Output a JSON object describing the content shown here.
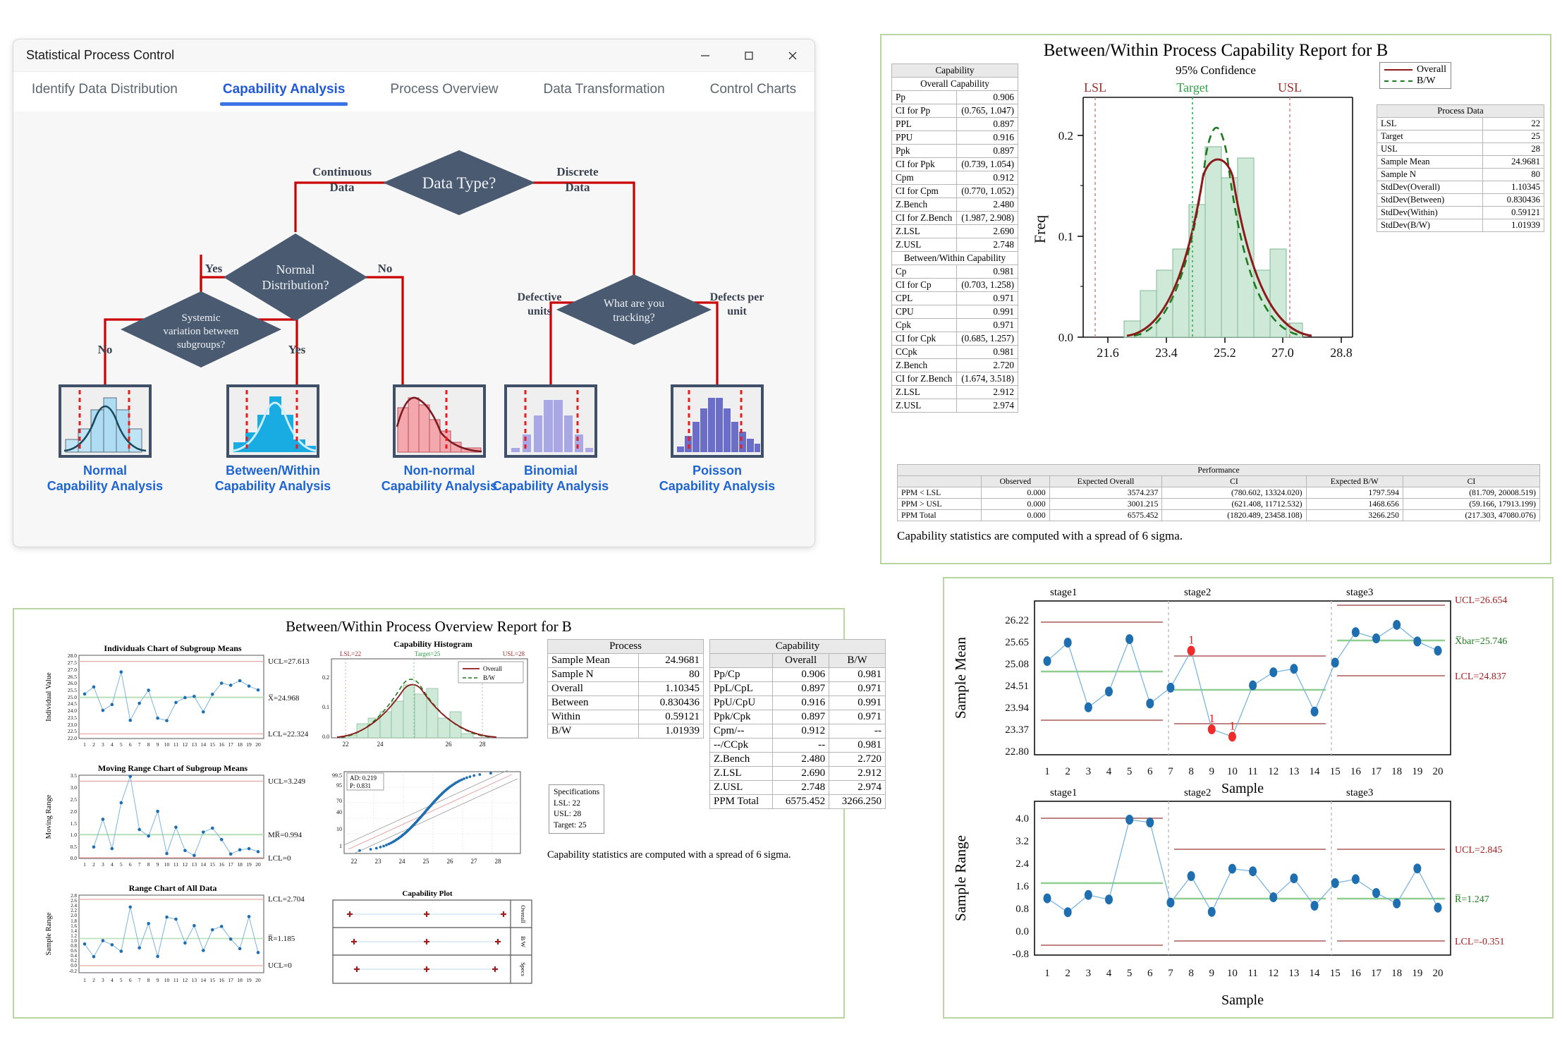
{
  "window": {
    "title": "Statistical Process Control",
    "controls": {
      "minimize": "—",
      "maximize": "☐",
      "close": "✕"
    },
    "tabs": [
      {
        "label": "Identify Data Distribution",
        "active": false
      },
      {
        "label": "Capability Analysis",
        "active": true
      },
      {
        "label": "Process Overview",
        "active": false
      },
      {
        "label": "Data Transformation",
        "active": false
      },
      {
        "label": "Control Charts",
        "active": false
      }
    ]
  },
  "flowchart": {
    "nodes": {
      "data_type": "Data Type?",
      "normal_dist": "Normal\nDistribution?",
      "systemic": "Systemic\nvariation between\nsubgroups?",
      "tracking": "What are you\ntracking?"
    },
    "edge_labels": {
      "continuous": "Continuous\nData",
      "discrete": "Discrete\nData",
      "norm_yes": "Yes",
      "norm_no": "No",
      "sys_no": "No",
      "sys_yes": "Yes",
      "defective": "Defective\nunits",
      "defects": "Defects per\nunit"
    },
    "outcomes": [
      {
        "name": "Normal",
        "sub": "Capability Analysis",
        "thumb": "normal-histogram"
      },
      {
        "name": "Between/Within",
        "sub": "Capability Analysis",
        "thumb": "between-within-histogram"
      },
      {
        "name": "Non-normal",
        "sub": "Capability Analysis",
        "thumb": "nonnormal-histogram"
      },
      {
        "name": "Binomial",
        "sub": "Capability Analysis",
        "thumb": "binomial-histogram"
      },
      {
        "name": "Poisson",
        "sub": "Capability Analysis",
        "thumb": "poisson-histogram"
      }
    ],
    "colors": {
      "node": "#4a5a70",
      "edge": "#cc0000",
      "label": "#1e64d2"
    }
  },
  "capability_report": {
    "title": "Between/Within Process Capability Report for B",
    "subtitle": "95% Confidence",
    "footnote": "Capability statistics are computed with a spread of 6 sigma.",
    "capability_table": {
      "header": "Capability",
      "section1": "Overall Capability",
      "rows1": [
        [
          "Pp",
          "0.906"
        ],
        [
          "CI for Pp",
          "(0.765, 1.047)"
        ],
        [
          "PPL",
          "0.897"
        ],
        [
          "PPU",
          "0.916"
        ],
        [
          "Ppk",
          "0.897"
        ],
        [
          "CI for Ppk",
          "(0.739, 1.054)"
        ],
        [
          "Cpm",
          "0.912"
        ],
        [
          "CI for Cpm",
          "(0.770, 1.052)"
        ],
        [
          "Z.Bench",
          "2.480"
        ],
        [
          "CI for Z.Bench",
          "(1.987, 2.908)"
        ],
        [
          "Z.LSL",
          "2.690"
        ],
        [
          "Z.USL",
          "2.748"
        ]
      ],
      "section2": "Between/Within Capability",
      "rows2": [
        [
          "Cp",
          "0.981"
        ],
        [
          "CI for Cp",
          "(0.703, 1.258)"
        ],
        [
          "CPL",
          "0.971"
        ],
        [
          "CPU",
          "0.991"
        ],
        [
          "Cpk",
          "0.971"
        ],
        [
          "CI for Cpk",
          "(0.685, 1.257)"
        ],
        [
          "CCpk",
          "0.981"
        ],
        [
          "Z.Bench",
          "2.720"
        ],
        [
          "CI for Z.Bench",
          "(1.674, 3.518)"
        ],
        [
          "Z.LSL",
          "2.912"
        ],
        [
          "Z.USL",
          "2.974"
        ]
      ]
    },
    "legend": {
      "overall": "Overall",
      "bw": "B/W"
    },
    "process_data": {
      "header": "Process Data",
      "rows": [
        [
          "LSL",
          "22"
        ],
        [
          "Target",
          "25"
        ],
        [
          "USL",
          "28"
        ],
        [
          "Sample Mean",
          "24.9681"
        ],
        [
          "Sample N",
          "80"
        ],
        [
          "StdDev(Overall)",
          "1.10345"
        ],
        [
          "StdDev(Between)",
          "0.830436"
        ],
        [
          "StdDev(Within)",
          "0.59121"
        ],
        [
          "StdDev(B/W)",
          "1.01939"
        ]
      ]
    },
    "performance": {
      "header": "Performance",
      "columns": [
        "",
        "Observed",
        "Expected Overall",
        "CI",
        "Expected B/W",
        "CI"
      ],
      "rows": [
        [
          "PPM < LSL",
          "0.000",
          "3574.237",
          "(780.602, 13324.020)",
          "1797.594",
          "(81.709, 20008.519)"
        ],
        [
          "PPM > USL",
          "0.000",
          "3001.215",
          "(621.408, 11712.532)",
          "1468.656",
          "(59.166, 17913.199)"
        ],
        [
          "PPM Total",
          "0.000",
          "6575.452",
          "(1820.489, 23458.108)",
          "3266.250",
          "(217.303, 47080.076)"
        ]
      ]
    },
    "markers": {
      "lsl": "LSL",
      "target": "Target",
      "usl": "USL"
    }
  },
  "overview_report": {
    "title": "Between/Within Process Overview Report for B",
    "footnote": "Capability statistics are computed with a spread of 6 sigma.",
    "specifications": {
      "header": "Specifications",
      "lines": [
        "LSL: 22",
        "USL: 28",
        "Target: 25"
      ]
    },
    "process_table": {
      "header": "Process",
      "rows": [
        [
          "Sample Mean",
          "24.9681"
        ],
        [
          "Sample N",
          "80"
        ],
        [
          "Overall",
          "1.10345"
        ],
        [
          "Between",
          "0.830436"
        ],
        [
          "Within",
          "0.59121"
        ],
        [
          "B/W",
          "1.01939"
        ]
      ]
    },
    "capability_table": {
      "header": "Capability",
      "columns": [
        "",
        "Overall",
        "B/W"
      ],
      "rows": [
        [
          "Pp/Cp",
          "0.906",
          "0.981"
        ],
        [
          "PpL/CpL",
          "0.897",
          "0.971"
        ],
        [
          "PpU/CpU",
          "0.916",
          "0.991"
        ],
        [
          "Ppk/Cpk",
          "0.897",
          "0.971"
        ],
        [
          "Cpm/--",
          "0.912",
          "--"
        ],
        [
          "--/CCpk",
          "--",
          "0.981"
        ],
        [
          "Z.Bench",
          "2.480",
          "2.720"
        ],
        [
          "Z.LSL",
          "2.690",
          "2.912"
        ],
        [
          "Z.USL",
          "2.748",
          "2.974"
        ],
        [
          "PPM Total",
          "6575.452",
          "3266.250"
        ]
      ]
    },
    "capability_plot": {
      "title": "Capability Plot",
      "rows": [
        "Overall",
        "B/W",
        "Specs"
      ]
    },
    "anderson_darling": {
      "ad": "AD: 0.219",
      "p": "P: 0.831"
    },
    "legend": {
      "overall": "Overall",
      "bw": "B/W"
    }
  },
  "chart_data": [
    {
      "type": "bar",
      "id": "capability-histogram-main",
      "title": "Between/Within Process Capability Report for B",
      "xlabel": "",
      "ylabel": "Freq",
      "xticks": [
        "21.6",
        "23.4",
        "25.2",
        "27.0",
        "28.8"
      ],
      "yticks": [
        "0.0",
        "0.1",
        "0.2"
      ],
      "xlim": [
        21.0,
        29.4
      ],
      "ylim": [
        0.0,
        0.235
      ],
      "bin_edges": [
        22.1,
        22.6,
        23.1,
        23.6,
        24.1,
        24.6,
        25.1,
        25.6,
        26.1,
        26.6,
        27.1,
        27.6
      ],
      "values": [
        0.015,
        0.043,
        0.062,
        0.082,
        0.124,
        0.178,
        0.149,
        0.167,
        0.062,
        0.082,
        0.013
      ],
      "curves": [
        {
          "name": "Overall",
          "color": "#8b1a1a",
          "style": "solid",
          "mean": 24.9681,
          "sd": 1.10345,
          "peak": 0.172
        },
        {
          "name": "B/W",
          "color": "#1e7a1e",
          "style": "dashed",
          "mean": 25.05,
          "sd": 1.01939,
          "peak": 0.192
        }
      ],
      "reference_lines": [
        {
          "label": "LSL",
          "value": 22,
          "color": "#b03030"
        },
        {
          "label": "Target",
          "value": 25,
          "color": "#2f9e44"
        },
        {
          "label": "USL",
          "value": 28,
          "color": "#b03030"
        }
      ]
    },
    {
      "type": "line",
      "id": "individuals-chart",
      "title": "Individuals Chart of Subgroup Means",
      "xlabel": "",
      "ylabel": "Individual Value",
      "categories": [
        1,
        2,
        3,
        4,
        5,
        6,
        7,
        8,
        9,
        10,
        11,
        12,
        13,
        14,
        15,
        16,
        17,
        18,
        19,
        20
      ],
      "values": [
        25.21,
        25.72,
        24.03,
        24.45,
        26.8,
        23.31,
        24.54,
        25.48,
        23.47,
        23.29,
        24.6,
        24.95,
        25.04,
        23.92,
        25.19,
        25.99,
        25.84,
        26.17,
        25.78,
        25.5
      ],
      "yticks": [
        "22.0",
        "22.5",
        "23.0",
        "23.5",
        "24.0",
        "24.5",
        "25.0",
        "25.5",
        "26.0",
        "26.5",
        "27.0",
        "27.5",
        "28.0"
      ],
      "ylim": [
        22.0,
        28.0
      ],
      "limits": {
        "ucl_label": "UCL=27.613",
        "ucl": 27.613,
        "center_label": "X̅=24.968",
        "center": 24.968,
        "lcl_label": "LCL=22.324",
        "lcl": 22.324
      }
    },
    {
      "type": "line",
      "id": "moving-range-chart",
      "title": "Moving Range Chart of Subgroup Means",
      "xlabel": "",
      "ylabel": "Moving Range",
      "categories": [
        1,
        2,
        3,
        4,
        5,
        6,
        7,
        8,
        9,
        10,
        11,
        12,
        13,
        14,
        15,
        16,
        17,
        18,
        19,
        20
      ],
      "values": [
        null,
        0.47,
        1.66,
        0.4,
        2.37,
        3.5,
        1.22,
        0.94,
        2.0,
        0.19,
        1.32,
        0.32,
        0.11,
        1.11,
        1.28,
        0.79,
        0.17,
        0.35,
        0.4,
        0.27
      ],
      "yticks": [
        "0.0",
        "0.5",
        "1.0",
        "1.5",
        "2.0",
        "2.5",
        "3.0",
        "3.5"
      ],
      "ylim": [
        0.0,
        3.5
      ],
      "limits": {
        "ucl_label": "UCL=3.249",
        "ucl": 3.249,
        "center_label": "MR̅=0.994",
        "center": 0.994,
        "lcl_label": "LCL=0",
        "lcl": 0
      }
    },
    {
      "type": "line",
      "id": "range-chart-all-data",
      "title": "Range Chart of All Data",
      "xlabel": "",
      "ylabel": "Sample Range",
      "categories": [
        1,
        2,
        3,
        4,
        5,
        6,
        7,
        8,
        9,
        10,
        11,
        12,
        13,
        14,
        15,
        16,
        17,
        18,
        19,
        20
      ],
      "values": [
        0.91,
        0.42,
        1.04,
        0.88,
        0.63,
        2.34,
        0.76,
        1.7,
        0.43,
        1.95,
        1.87,
        0.95,
        1.62,
        0.66,
        1.46,
        1.59,
        1.1,
        0.73,
        1.97,
        0.58
      ],
      "yticks": [
        "-0.2",
        "0.0",
        "0.2",
        "0.4",
        "0.6",
        "0.8",
        "1.0",
        "1.2",
        "1.4",
        "1.6",
        "1.8",
        "2.0",
        "2.2",
        "2.4",
        "2.6",
        "2.8"
      ],
      "ylim": [
        -0.2,
        2.8
      ],
      "limits": {
        "ucl_label": "LCL=2.704",
        "ucl": 2.704,
        "center_label": "R̅=1.185",
        "center": 1.185,
        "lcl_label": "UCL=0",
        "lcl": 0
      }
    },
    {
      "type": "bar",
      "id": "capability-histogram-small",
      "title": "Capability Histogram",
      "xticks": [
        "22",
        "24",
        "26",
        "28"
      ],
      "xlim": [
        21.6,
        28.6
      ],
      "bin_edges": [
        22.1,
        22.6,
        23.1,
        23.6,
        24.1,
        24.6,
        25.1,
        25.6,
        26.1,
        26.6,
        27.1,
        27.6
      ],
      "values": [
        0.015,
        0.043,
        0.062,
        0.082,
        0.124,
        0.178,
        0.149,
        0.167,
        0.062,
        0.082,
        0.013
      ],
      "reference_lines": [
        {
          "label": "LSL=22",
          "value": 22,
          "color": "#b03030"
        },
        {
          "label": "Target=25",
          "value": 25,
          "color": "#2f9e44"
        },
        {
          "label": "USL=28",
          "value": 28,
          "color": "#b03030"
        }
      ]
    },
    {
      "type": "scatter",
      "id": "normal-probability-plot",
      "title": "",
      "yticks": [
        "1",
        "10",
        "40",
        "70",
        "95",
        "99.5"
      ],
      "xticks": [
        "22",
        "23",
        "24",
        "25",
        "26",
        "27",
        "28"
      ],
      "annotation": [
        "AD: 0.219",
        "P: 0.831"
      ]
    },
    {
      "type": "line",
      "id": "xbar-chart-staged",
      "title": "",
      "xlabel": "Sample",
      "ylabel": "Sample Mean",
      "stages": [
        "stage1",
        "stage2",
        "stage3"
      ],
      "stage_ranges": [
        [
          1,
          6
        ],
        [
          7,
          14
        ],
        [
          15,
          20
        ]
      ],
      "categories": [
        1,
        2,
        3,
        4,
        5,
        6,
        7,
        8,
        9,
        10,
        11,
        12,
        13,
        14,
        15,
        16,
        17,
        18,
        19,
        20
      ],
      "values": [
        25.23,
        25.71,
        24.03,
        24.44,
        25.8,
        24.13,
        24.54,
        25.5,
        23.46,
        23.27,
        24.6,
        24.94,
        25.03,
        23.92,
        25.19,
        25.98,
        25.82,
        26.17,
        25.74,
        25.5
      ],
      "violations": [
        8,
        9,
        10
      ],
      "violation_label": "1",
      "yticks": [
        "22.80",
        "23.37",
        "23.94",
        "24.51",
        "25.08",
        "25.65",
        "26.22"
      ],
      "ylim": [
        22.8,
        26.79
      ],
      "stage_limits": [
        {
          "ucl": 26.19,
          "center": 24.9,
          "lcl": 23.62
        },
        {
          "ucl": 25.3,
          "center": 24.42,
          "lcl": 23.5
        },
        {
          "ucl": 26.654,
          "center": 25.746,
          "lcl": 24.837
        }
      ],
      "limit_labels": {
        "ucl": "UCL=26.654",
        "center": "Xbar=25.746",
        "lcl": "LCL=24.837"
      }
    },
    {
      "type": "line",
      "id": "r-chart-staged",
      "title": "",
      "xlabel": "Sample",
      "ylabel": "Sample Range",
      "stages": [
        "stage1",
        "stage2",
        "stage3"
      ],
      "stage_ranges": [
        [
          1,
          6
        ],
        [
          7,
          14
        ],
        [
          15,
          20
        ]
      ],
      "categories": [
        1,
        2,
        3,
        4,
        5,
        6,
        7,
        8,
        9,
        10,
        11,
        12,
        13,
        14,
        15,
        16,
        17,
        18,
        19,
        20
      ],
      "values": [
        0.91,
        0.42,
        1.03,
        0.87,
        3.7,
        3.6,
        0.76,
        1.7,
        0.43,
        1.96,
        1.87,
        0.95,
        1.62,
        0.65,
        1.45,
        1.59,
        1.1,
        0.73,
        1.97,
        0.58
      ],
      "yticks": [
        "-0.8",
        "0.0",
        "0.8",
        "1.6",
        "2.4",
        "3.2",
        "4.0"
      ],
      "ylim": [
        -1.1,
        4.35
      ],
      "stage_limits": [
        {
          "ucl": 4.02,
          "center": 1.76,
          "lcl": -0.43
        },
        {
          "ucl": 2.845,
          "center": 1.247,
          "lcl": -0.351
        },
        {
          "ucl": 2.845,
          "center": 1.247,
          "lcl": -0.351
        }
      ],
      "limit_labels": {
        "ucl": "UCL=2.845",
        "center": "R̅=1.247",
        "lcl": "LCL=-0.351"
      }
    }
  ]
}
